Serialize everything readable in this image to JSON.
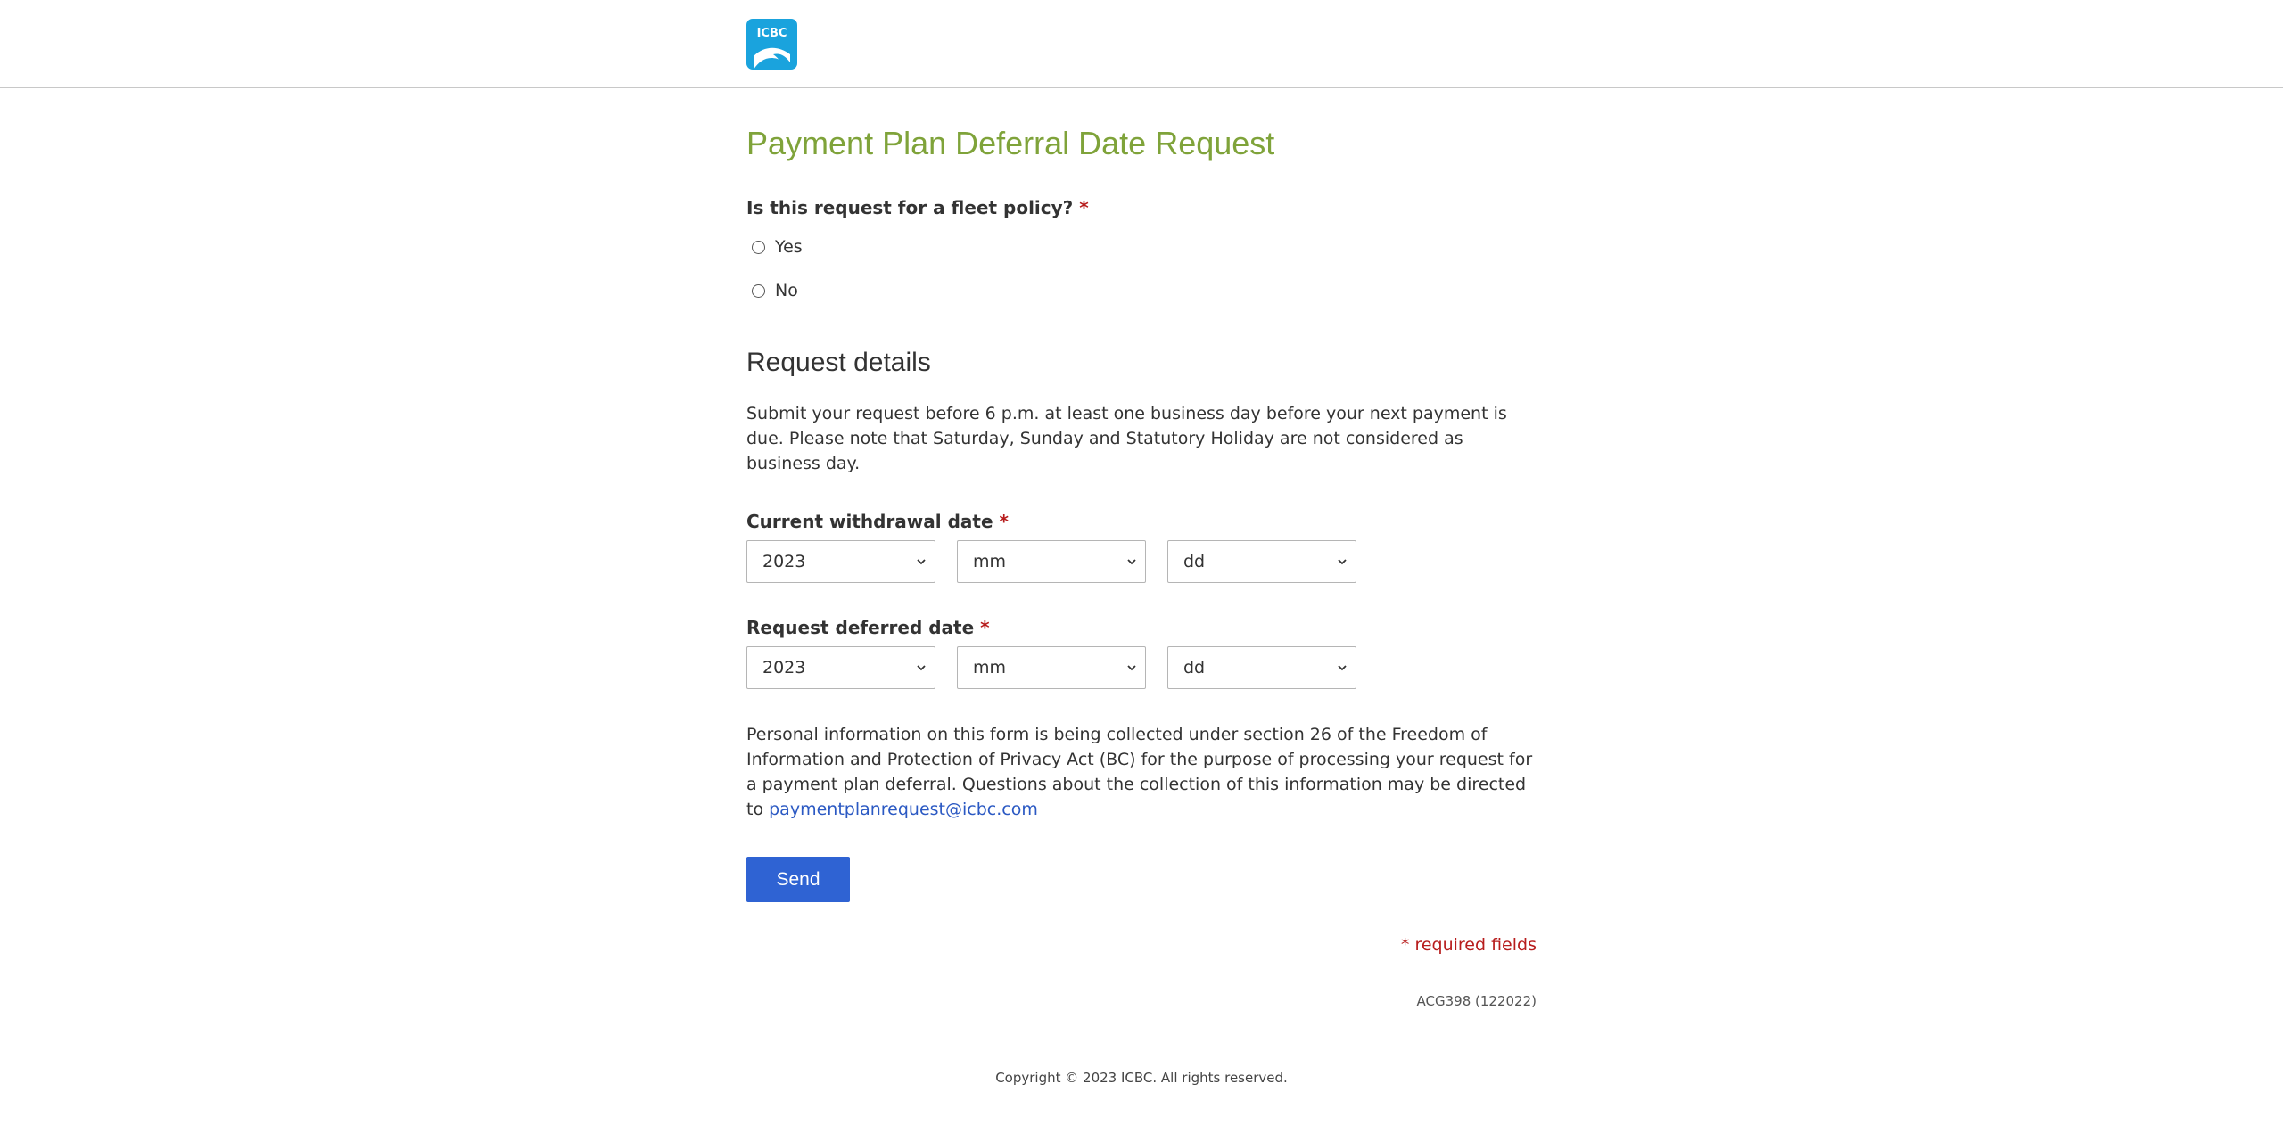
{
  "header": {
    "logo_text": "ICBC",
    "colors": {
      "brand_blue": "#1aa3dd"
    }
  },
  "form": {
    "title": "Payment Plan Deferral Date Request",
    "fleet_question": {
      "label": "Is this request for a fleet policy?",
      "required_mark": "*",
      "options": [
        "Yes",
        "No"
      ]
    },
    "request_details": {
      "heading": "Request details",
      "description": "Submit your request before 6 p.m. at least one business day before your next payment is due. Please note that Saturday, Sunday and Statutory Holiday are not considered as business day."
    },
    "current_withdrawal": {
      "label": "Current withdrawal date",
      "required_mark": "*",
      "year": "2023",
      "month": "mm",
      "day": "dd"
    },
    "requested_deferred": {
      "label": "Request deferred date",
      "required_mark": "*",
      "year": "2023",
      "month": "mm",
      "day": "dd"
    },
    "privacy": {
      "text": "Personal information on this form is being collected under section 26 of the Freedom of Information and Protection of Privacy Act (BC) for the purpose of processing your request for a payment plan deferral. Questions about the collection of this information may be directed to",
      "email": "paymentplanrequest@icbc.com"
    },
    "send_label": "Send",
    "required_note": "* required fields",
    "form_code": "ACG398 (122022)"
  },
  "footer": {
    "copyright": "Copyright © 2023 ICBC. All rights reserved."
  },
  "colors": {
    "title_green": "#7fa33a",
    "required_red": "#b71c1c",
    "link_blue": "#2b59c3",
    "button_blue": "#2f63d3"
  }
}
